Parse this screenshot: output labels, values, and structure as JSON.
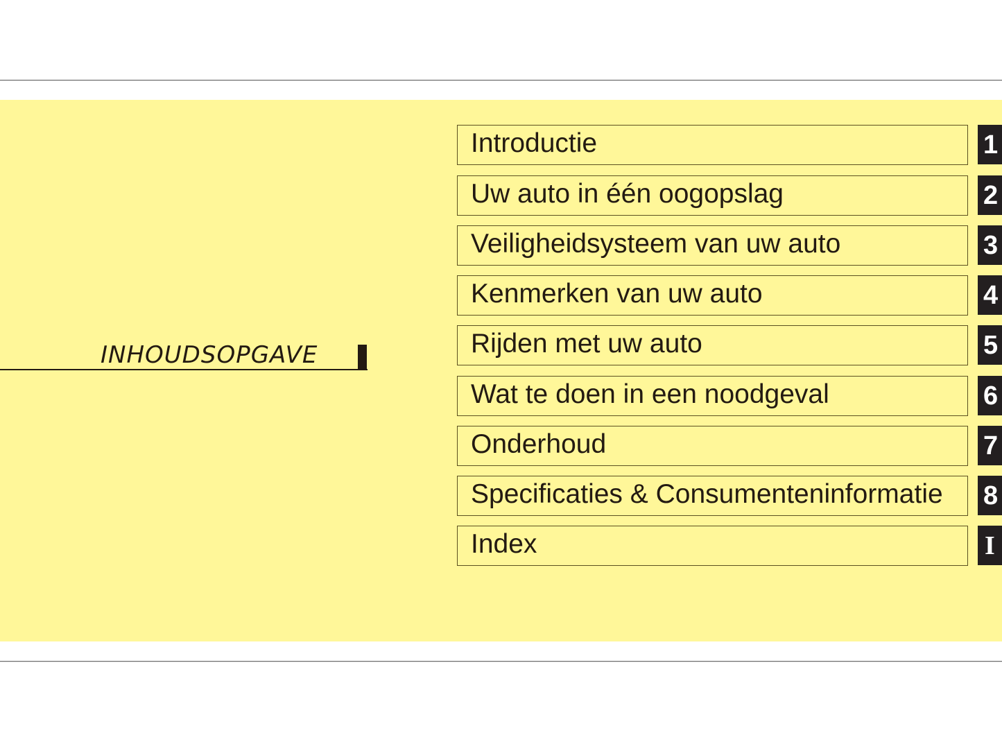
{
  "heading": {
    "title": "INHOUDSOPGAVE"
  },
  "toc": {
    "items": [
      {
        "label": "Introductie",
        "tab": "1"
      },
      {
        "label": "Uw auto in één oogopslag",
        "tab": "2"
      },
      {
        "label": "Veiligheidsysteem van uw auto",
        "tab": "3"
      },
      {
        "label": "Kenmerken van uw auto",
        "tab": "4"
      },
      {
        "label": "Rijden met uw auto",
        "tab": "5"
      },
      {
        "label": "Wat te doen in een noodgeval",
        "tab": "6"
      },
      {
        "label": "Onderhoud",
        "tab": "7"
      },
      {
        "label": "Specificaties & Consumenteninformatie",
        "tab": "8"
      },
      {
        "label": "Index",
        "tab": "I"
      }
    ]
  },
  "colors": {
    "panel_background": "#fff799",
    "text": "#231a12",
    "tab_background": "#231f20",
    "tab_text": "#ffffff"
  }
}
